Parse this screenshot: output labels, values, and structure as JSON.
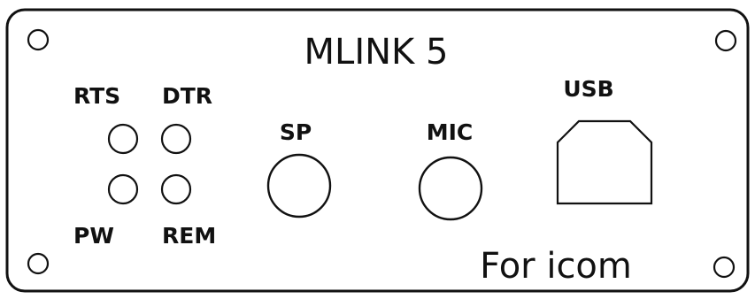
{
  "panel": {
    "title": "MLINK 5",
    "subtitle": "For icom",
    "led_labels": {
      "rts": "RTS",
      "dtr": "DTR",
      "pw": "PW",
      "rem": "REM"
    },
    "jack_labels": {
      "sp": "SP",
      "mic": "MIC"
    },
    "usb_label": "USB",
    "colors": {
      "line": "#111111",
      "background": "#ffffff"
    }
  }
}
